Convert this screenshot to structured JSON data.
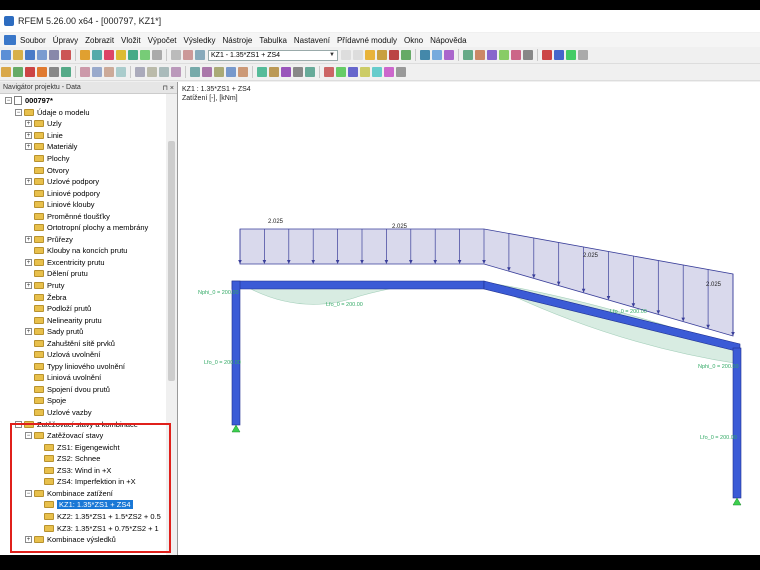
{
  "window": {
    "title": "RFEM 5.26.00 x64 - [000797, KZ1*]"
  },
  "menu": [
    "Soubor",
    "Úpravy",
    "Zobrazit",
    "Vložit",
    "Výpočet",
    "Výsledky",
    "Nástroje",
    "Tabulka",
    "Nastavení",
    "Přídavné moduly",
    "Okno",
    "Nápověda"
  ],
  "toolbar": {
    "combo_value": "KZ1 - 1.35*ZS1 + ZS4"
  },
  "navigator": {
    "title": "Navigátor projektu - Data",
    "pin": "⊓ ×",
    "tree": [
      {
        "level": 0,
        "exp": "-",
        "icon": "file",
        "label": "000797*",
        "bold": true
      },
      {
        "level": 1,
        "exp": "-",
        "icon": "folder",
        "label": "Údaje o modelu"
      },
      {
        "level": 2,
        "exp": "+",
        "icon": "folder",
        "label": "Uzly"
      },
      {
        "level": 2,
        "exp": "+",
        "icon": "folder",
        "label": "Linie"
      },
      {
        "level": 2,
        "exp": "+",
        "icon": "folder",
        "label": "Materiály"
      },
      {
        "level": 2,
        "exp": "",
        "icon": "folder",
        "label": "Plochy"
      },
      {
        "level": 2,
        "exp": "",
        "icon": "folder",
        "label": "Otvory"
      },
      {
        "level": 2,
        "exp": "+",
        "icon": "folder",
        "label": "Uzlové podpory"
      },
      {
        "level": 2,
        "exp": "",
        "icon": "folder",
        "label": "Liniové podpory"
      },
      {
        "level": 2,
        "exp": "",
        "icon": "folder",
        "label": "Liniové klouby"
      },
      {
        "level": 2,
        "exp": "",
        "icon": "folder",
        "label": "Proměnné tloušťky"
      },
      {
        "level": 2,
        "exp": "",
        "icon": "folder",
        "label": "Ortotropní plochy a membrány"
      },
      {
        "level": 2,
        "exp": "+",
        "icon": "folder",
        "label": "Průřezy"
      },
      {
        "level": 2,
        "exp": "",
        "icon": "folder",
        "label": "Klouby na koncích prutu"
      },
      {
        "level": 2,
        "exp": "+",
        "icon": "folder",
        "label": "Excentricity prutu"
      },
      {
        "level": 2,
        "exp": "",
        "icon": "folder",
        "label": "Dělení prutu"
      },
      {
        "level": 2,
        "exp": "+",
        "icon": "folder",
        "label": "Pruty"
      },
      {
        "level": 2,
        "exp": "",
        "icon": "folder",
        "label": "Žebra"
      },
      {
        "level": 2,
        "exp": "",
        "icon": "folder",
        "label": "Podloží prutů"
      },
      {
        "level": 2,
        "exp": "",
        "icon": "folder",
        "label": "Nelinearity prutu"
      },
      {
        "level": 2,
        "exp": "+",
        "icon": "folder",
        "label": "Sady prutů"
      },
      {
        "level": 2,
        "exp": "",
        "icon": "folder",
        "label": "Zahuštění sítě prvků"
      },
      {
        "level": 2,
        "exp": "",
        "icon": "folder",
        "label": "Uzlová uvolnění"
      },
      {
        "level": 2,
        "exp": "",
        "icon": "folder",
        "label": "Typy liniového uvolnění"
      },
      {
        "level": 2,
        "exp": "",
        "icon": "folder",
        "label": "Liniová uvolnění"
      },
      {
        "level": 2,
        "exp": "",
        "icon": "folder",
        "label": "Spojení dvou prutů"
      },
      {
        "level": 2,
        "exp": "",
        "icon": "folder",
        "label": "Spoje"
      },
      {
        "level": 2,
        "exp": "",
        "icon": "folder",
        "label": "Uzlové vazby"
      },
      {
        "level": 1,
        "exp": "-",
        "icon": "folder",
        "label": "Zatěžovací stavy a kombinace"
      },
      {
        "level": 2,
        "exp": "-",
        "icon": "folder",
        "label": "Zatěžovací stavy"
      },
      {
        "level": 3,
        "exp": "",
        "icon": "folder",
        "label": "ZS1: Eigengewicht"
      },
      {
        "level": 3,
        "exp": "",
        "icon": "folder",
        "label": "ZS2: Schnee"
      },
      {
        "level": 3,
        "exp": "",
        "icon": "folder",
        "label": "ZS3: Wind in +X"
      },
      {
        "level": 3,
        "exp": "",
        "icon": "folder",
        "label": "ZS4: Imperfektion in +X"
      },
      {
        "level": 2,
        "exp": "-",
        "icon": "folder",
        "label": "Kombinace zatížení"
      },
      {
        "level": 3,
        "exp": "",
        "icon": "folder",
        "label": "KZ1: 1.35*ZS1 + ZS4",
        "selected": true
      },
      {
        "level": 3,
        "exp": "",
        "icon": "folder",
        "label": "KZ2: 1.35*ZS1 + 1.5*ZS2 + 0.5"
      },
      {
        "level": 3,
        "exp": "",
        "icon": "folder",
        "label": "KZ3: 1.35*ZS1 + 0.75*ZS2 + 1"
      },
      {
        "level": 2,
        "exp": "+",
        "icon": "folder",
        "label": "Kombinace výsledků"
      }
    ]
  },
  "canvas": {
    "caption_line1": "KZ1 : 1.35*ZS1 + ZS4",
    "caption_line2": "Zatížení [-], [kNm]",
    "load_labels": [
      "2.025",
      "2.025",
      "2.025",
      "2.025"
    ],
    "member_labels": [
      "Nphi_0 = 200.00",
      "Lfo_0 = 200.00",
      "Lfo_0 = 200.00",
      "Lfo_0 = 200.00",
      "Nphi_0 = 200.00",
      "Lfo_0 = 200.00"
    ],
    "colors": {
      "frame": "#3b5bd6",
      "load_fill": "#d9d9ec",
      "load_stroke": "#3a3f9a",
      "deflection": "#cfe8dc",
      "support": "#3ccf4e"
    }
  }
}
